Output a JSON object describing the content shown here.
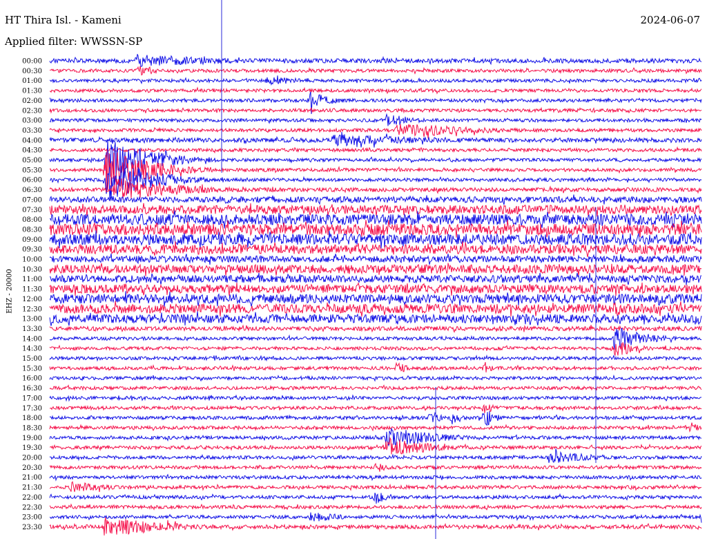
{
  "header": {
    "station": "HT Thira Isl. - Kameni",
    "date": "2024-06-07",
    "filter": "Applied filter: WWSSN-SP"
  },
  "channel_label": "EHZ - 20000",
  "colors": {
    "trace_a": "#1010e6",
    "trace_b": "#f5104a",
    "minute_marker": "#2a2ad8"
  },
  "chart_data": {
    "type": "line",
    "title": "",
    "xlabel": "",
    "ylabel": "EHZ - 20000",
    "row_labels": [
      "00:00",
      "00:30",
      "01:00",
      "01:30",
      "02:00",
      "02:30",
      "03:00",
      "03:30",
      "04:00",
      "04:30",
      "05:00",
      "05:30",
      "06:00",
      "06:30",
      "07:00",
      "07:30",
      "08:00",
      "08:30",
      "09:00",
      "09:30",
      "10:00",
      "10:30",
      "11:00",
      "11:30",
      "12:00",
      "12:30",
      "13:00",
      "13:30",
      "14:00",
      "14:30",
      "15:00",
      "15:30",
      "16:00",
      "16:30",
      "17:00",
      "17:30",
      "18:00",
      "18:30",
      "19:00",
      "19:30",
      "20:00",
      "20:30",
      "21:00",
      "21:30",
      "22:00",
      "22:30",
      "23:00",
      "23:30"
    ],
    "row_minutes": 30,
    "series_colors_alternate": [
      "blue",
      "red"
    ],
    "noise_amplitude_relative": [
      1.3,
      1.0,
      1.0,
      1.0,
      1.0,
      1.0,
      1.0,
      1.0,
      1.3,
      1.0,
      1.0,
      1.0,
      1.0,
      1.2,
      1.8,
      2.6,
      3.2,
      3.4,
      3.3,
      2.8,
      2.0,
      2.6,
      2.2,
      2.6,
      2.8,
      2.8,
      2.6,
      1.3,
      1.0,
      1.0,
      1.0,
      1.0,
      1.0,
      1.0,
      1.0,
      1.0,
      1.0,
      1.0,
      1.0,
      1.0,
      1.0,
      1.0,
      1.0,
      1.0,
      1.0,
      1.0,
      1.0,
      1.2
    ],
    "events": [
      {
        "row": "00:00",
        "minute": 4,
        "amplitude": 2.0,
        "duration_min": 4
      },
      {
        "row": "00:30",
        "minute": 4,
        "amplitude": 1.6,
        "duration_min": 1
      },
      {
        "row": "01:00",
        "minute": 10,
        "amplitude": 1.5,
        "duration_min": 1.5
      },
      {
        "row": "02:00",
        "minute": 12,
        "amplitude": 2.5,
        "duration_min": 1
      },
      {
        "row": "03:00",
        "minute": 15.5,
        "amplitude": 1.8,
        "duration_min": 1.5
      },
      {
        "row": "03:30",
        "minute": 16,
        "amplitude": 2.0,
        "duration_min": 4
      },
      {
        "row": "04:00",
        "minute": 13,
        "amplitude": 1.8,
        "duration_min": 5
      },
      {
        "row": "05:00",
        "minute": 2.6,
        "amplitude": 7.0,
        "duration_min": 2
      },
      {
        "row": "05:30",
        "minute": 2.6,
        "amplitude": 7.0,
        "duration_min": 2
      },
      {
        "row": "06:00",
        "minute": 2.6,
        "amplitude": 6.5,
        "duration_min": 2
      },
      {
        "row": "06:30",
        "minute": 3.0,
        "amplitude": 3.5,
        "duration_min": 3
      },
      {
        "row": "09:30",
        "minute": 21,
        "amplitude": 1.8,
        "duration_min": 1
      },
      {
        "row": "12:00",
        "minute": 28,
        "amplitude": 2.0,
        "duration_min": 1
      },
      {
        "row": "12:30",
        "minute": 26,
        "amplitude": 2.5,
        "duration_min": 0.5
      },
      {
        "row": "14:00",
        "minute": 26,
        "amplitude": 3.5,
        "duration_min": 1.5
      },
      {
        "row": "14:30",
        "minute": 26,
        "amplitude": 2.5,
        "duration_min": 1
      },
      {
        "row": "15:30",
        "minute": 16,
        "amplitude": 1.8,
        "duration_min": 0.5
      },
      {
        "row": "15:30",
        "minute": 20,
        "amplitude": 1.4,
        "duration_min": 0.5
      },
      {
        "row": "17:30",
        "minute": 20,
        "amplitude": 2.5,
        "duration_min": 0.5
      },
      {
        "row": "18:00",
        "minute": 17.5,
        "amplitude": 2.2,
        "duration_min": 0.5
      },
      {
        "row": "18:00",
        "minute": 18.5,
        "amplitude": 2.2,
        "duration_min": 0.5
      },
      {
        "row": "18:00",
        "minute": 20,
        "amplitude": 3.0,
        "duration_min": 0.5
      },
      {
        "row": "18:30",
        "minute": 29.5,
        "amplitude": 1.8,
        "duration_min": 0.4
      },
      {
        "row": "19:00",
        "minute": 15.5,
        "amplitude": 3.5,
        "duration_min": 2
      },
      {
        "row": "19:30",
        "minute": 15.5,
        "amplitude": 3.0,
        "duration_min": 2
      },
      {
        "row": "20:00",
        "minute": 23,
        "amplitude": 2.0,
        "duration_min": 2
      },
      {
        "row": "20:30",
        "minute": 15,
        "amplitude": 1.8,
        "duration_min": 0.5
      },
      {
        "row": "21:00",
        "minute": 31,
        "amplitude": 1.6,
        "duration_min": 1.5
      },
      {
        "row": "21:30",
        "minute": 1,
        "amplitude": 1.6,
        "duration_min": 2
      },
      {
        "row": "22:00",
        "minute": 15,
        "amplitude": 2.2,
        "duration_min": 0.5
      },
      {
        "row": "23:00",
        "minute": 12,
        "amplitude": 1.6,
        "duration_min": 1.5
      },
      {
        "row": "23:00",
        "minute": 30,
        "amplitude": 1.6,
        "duration_min": 2
      },
      {
        "row": "23:30",
        "minute": 2.5,
        "amplitude": 3.0,
        "duration_min": 3
      }
    ]
  }
}
